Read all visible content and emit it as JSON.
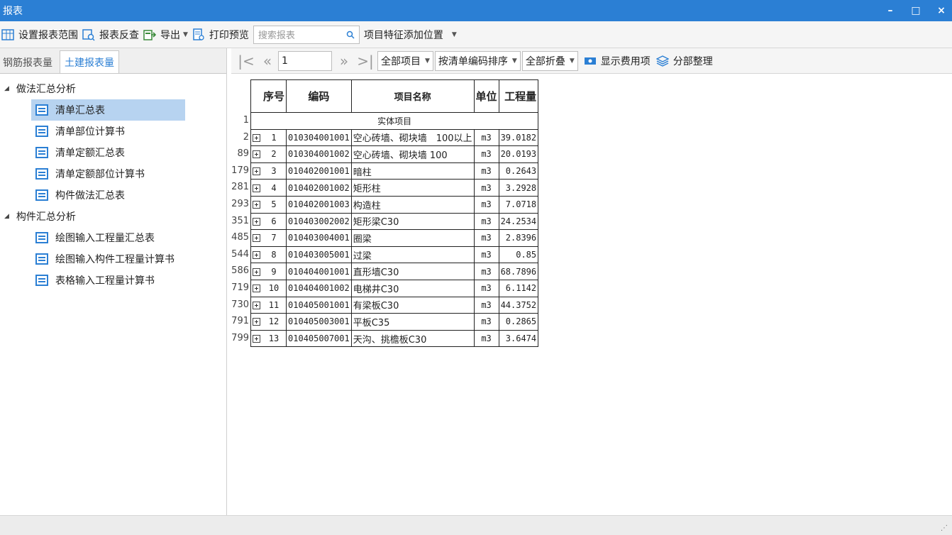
{
  "window": {
    "title": "报表",
    "minimize": "–",
    "maximize": "□",
    "close": "×"
  },
  "toolbar": {
    "set_range": "设置报表范围",
    "review": "报表反查",
    "export": "导出",
    "print_preview": "打印预览",
    "search_placeholder": "搜索报表",
    "feature_position": "项目特征添加位置"
  },
  "left": {
    "tabs": [
      "钢筋报表量",
      "土建报表量"
    ],
    "active_tab": 1,
    "groups": [
      {
        "label": "做法汇总分析",
        "items": [
          "清单汇总表",
          "清单部位计算书",
          "清单定额汇总表",
          "清单定额部位计算书",
          "构件做法汇总表"
        ]
      },
      {
        "label": "构件汇总分析",
        "items": [
          "绘图输入工程量汇总表",
          "绘图输入构件工程量计算书",
          "表格输入工程量计算书"
        ]
      }
    ],
    "selected_item": "清单汇总表"
  },
  "nav": {
    "first": "|<",
    "prev": "«",
    "page": "1",
    "next": "»",
    "last": ">|",
    "scope": "全部项目",
    "sort": "按清单编码排序",
    "fold": "全部折叠",
    "show_fee": "显示费用项",
    "organize": "分部整理"
  },
  "table": {
    "headers": {
      "seq": "序号",
      "code": "编码",
      "name": "项目名称",
      "unit": "单位",
      "qty": "工程量"
    },
    "section_label": "实体项目",
    "section_row_num": "1",
    "rows": [
      {
        "rownum": "2",
        "seq": "1",
        "code": "010304001001",
        "name": "空心砖墙、砌块墙　100以上",
        "unit": "m3",
        "qty": "39.0182"
      },
      {
        "rownum": "89",
        "seq": "2",
        "code": "010304001002",
        "name": "空心砖墙、砌块墙 100",
        "unit": "m3",
        "qty": "20.0193"
      },
      {
        "rownum": "179",
        "seq": "3",
        "code": "010402001001",
        "name": "暗柱",
        "unit": "m3",
        "qty": "0.2643"
      },
      {
        "rownum": "281",
        "seq": "4",
        "code": "010402001002",
        "name": "矩形柱",
        "unit": "m3",
        "qty": "3.2928"
      },
      {
        "rownum": "293",
        "seq": "5",
        "code": "010402001003",
        "name": "构造柱",
        "unit": "m3",
        "qty": "7.0718"
      },
      {
        "rownum": "351",
        "seq": "6",
        "code": "010403002002",
        "name": "矩形梁C30",
        "unit": "m3",
        "qty": "24.2534"
      },
      {
        "rownum": "485",
        "seq": "7",
        "code": "010403004001",
        "name": "圈梁",
        "unit": "m3",
        "qty": "2.8396"
      },
      {
        "rownum": "544",
        "seq": "8",
        "code": "010403005001",
        "name": "过梁",
        "unit": "m3",
        "qty": "0.85"
      },
      {
        "rownum": "586",
        "seq": "9",
        "code": "010404001001",
        "name": "直形墙C30",
        "unit": "m3",
        "qty": "68.7896"
      },
      {
        "rownum": "719",
        "seq": "10",
        "code": "010404001002",
        "name": "电梯井C30",
        "unit": "m3",
        "qty": "6.1142"
      },
      {
        "rownum": "730",
        "seq": "11",
        "code": "010405001001",
        "name": "有梁板C30",
        "unit": "m3",
        "qty": "44.3752"
      },
      {
        "rownum": "791",
        "seq": "12",
        "code": "010405003001",
        "name": "平板C35",
        "unit": "m3",
        "qty": "0.2865"
      },
      {
        "rownum": "799",
        "seq": "13",
        "code": "010405007001",
        "name": "天沟、挑檐板C30",
        "unit": "m3",
        "qty": "3.6474"
      }
    ]
  },
  "colors": {
    "titlebar": "#2b7fd4",
    "selection": "#b7d3f0",
    "accent": "#2b7fd4"
  },
  "icons": [
    "range-icon",
    "review-icon",
    "export-icon",
    "print-preview-icon",
    "search-icon",
    "fee-icon",
    "organize-icon",
    "doc-icon",
    "plus-box-icon"
  ]
}
